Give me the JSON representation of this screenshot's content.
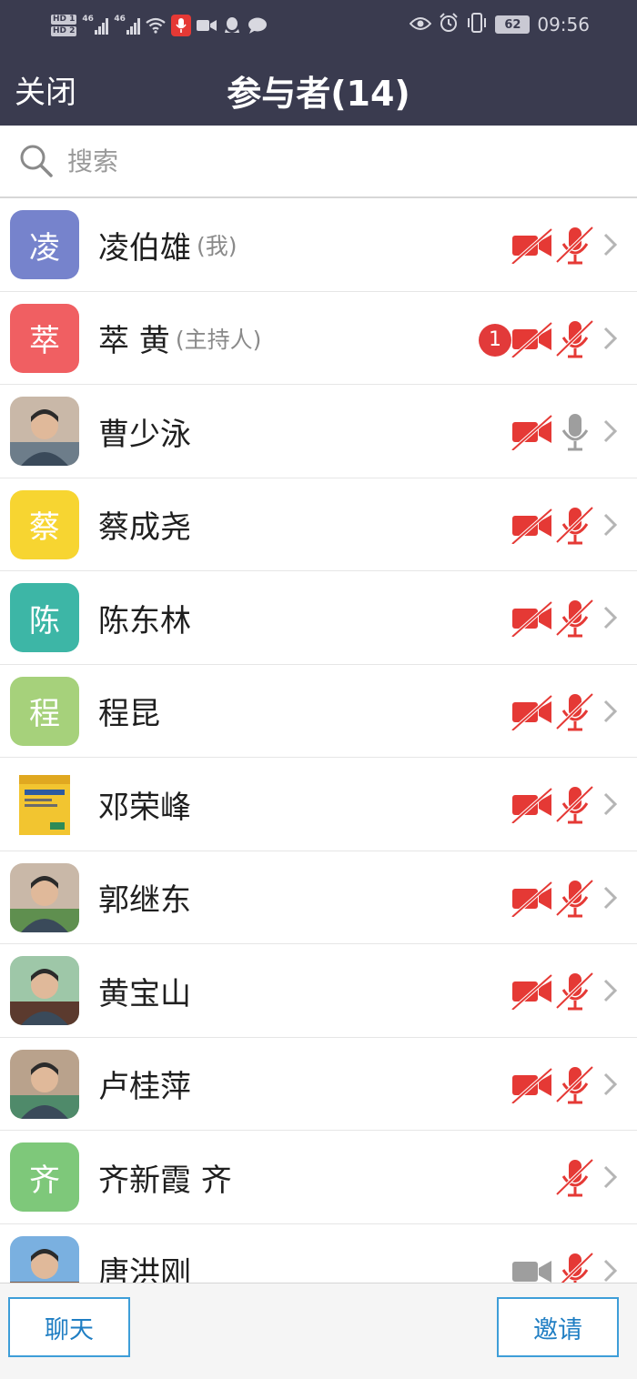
{
  "status_bar": {
    "hd1": "HD 1",
    "hd2": "HD 2",
    "net1": "46",
    "net2": "46",
    "battery": "62",
    "time": "09:56"
  },
  "header": {
    "close_label": "关闭",
    "title": "参与者(14)"
  },
  "search": {
    "placeholder": "搜索"
  },
  "colors": {
    "header_bg": "#3a3b4f",
    "muted_red": "#e53935",
    "active_gray": "#9e9e9e",
    "button_blue": "#1f7ec3"
  },
  "participants": [
    {
      "name": "凌伯雄",
      "role": "(我)",
      "avatar_text": "凌",
      "avatar_color": "#7683cc",
      "avatar_type": "letter",
      "badge": "",
      "camera": "off",
      "mic": "muted"
    },
    {
      "name": "萃 黄",
      "role": "(主持人)",
      "avatar_text": "萃",
      "avatar_color": "#f05f62",
      "avatar_type": "letter",
      "badge": "1",
      "camera": "off",
      "mic": "muted"
    },
    {
      "name": "曹少泳",
      "role": "",
      "avatar_text": "",
      "avatar_color": "#6d7d8a",
      "avatar_type": "photo",
      "badge": "",
      "camera": "off",
      "mic": "on"
    },
    {
      "name": "蔡成尧",
      "role": "",
      "avatar_text": "蔡",
      "avatar_color": "#f7d531",
      "avatar_type": "letter",
      "badge": "",
      "camera": "off",
      "mic": "muted"
    },
    {
      "name": "陈东林",
      "role": "",
      "avatar_text": "陈",
      "avatar_color": "#3db6a6",
      "avatar_type": "letter",
      "badge": "",
      "camera": "off",
      "mic": "muted"
    },
    {
      "name": "程昆",
      "role": "",
      "avatar_text": "程",
      "avatar_color": "#a6d17b",
      "avatar_type": "letter",
      "badge": "",
      "camera": "off",
      "mic": "muted"
    },
    {
      "name": "邓荣峰",
      "role": "",
      "avatar_text": "",
      "avatar_color": "#f2c530",
      "avatar_type": "book",
      "badge": "",
      "camera": "off",
      "mic": "muted"
    },
    {
      "name": "郭继东",
      "role": "",
      "avatar_text": "",
      "avatar_color": "#5f8f4f",
      "avatar_type": "photo",
      "badge": "",
      "camera": "off",
      "mic": "muted"
    },
    {
      "name": "黄宝山",
      "role": "",
      "avatar_text": "",
      "avatar_color": "#5b3a2e",
      "avatar_type": "photo",
      "badge": "",
      "camera": "off",
      "mic": "muted"
    },
    {
      "name": "卢桂萍",
      "role": "",
      "avatar_text": "",
      "avatar_color": "#4f8a6a",
      "avatar_type": "photo",
      "badge": "",
      "camera": "off",
      "mic": "muted"
    },
    {
      "name": "齐新霞 齐",
      "role": "",
      "avatar_text": "齐",
      "avatar_color": "#7ec87a",
      "avatar_type": "letter",
      "badge": "",
      "camera": "none",
      "mic": "muted"
    },
    {
      "name": "唐洪刚",
      "role": "",
      "avatar_text": "",
      "avatar_color": "#7b5a48",
      "avatar_type": "photo",
      "badge": "",
      "camera": "on",
      "mic": "muted"
    }
  ],
  "footer": {
    "chat_label": "聊天",
    "invite_label": "邀请"
  }
}
